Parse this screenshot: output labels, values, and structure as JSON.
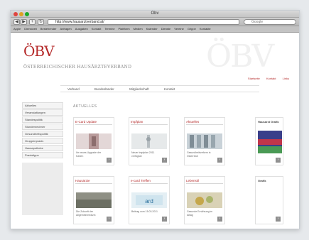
{
  "window": {
    "title": "Öbv",
    "url": "http://www.hausarztverband.at/",
    "search_placeholder": "Google"
  },
  "bookmarks": [
    "Apple",
    "Dienstzeit",
    "Bestehender",
    "Anfragen",
    "Ausgaben",
    "Kontakt",
    "Termine",
    "Plattform",
    "Medien",
    "Kalender",
    "Dienste",
    "Vereine",
    "Grippe",
    "Kontakte"
  ],
  "site": {
    "logo": "ÖBV",
    "tagline": "ÖSTERREICHISCHER HAUSÄRZTEVERBAND",
    "watermark": "ÖBV",
    "toplinks": [
      "Startseite",
      "Kontakt",
      "Links"
    ],
    "menu": [
      "Verband",
      "Bundesländer",
      "Mitgliedschaft",
      "Kontakt"
    ]
  },
  "sidebar": {
    "items": [
      "Aktuelles",
      "Veranstaltungen",
      "Standespolitik",
      "Stundenrechner",
      "Gesundheitspolitik",
      "Gruppenpraxis",
      "Hausapotheke",
      "Praxistipps"
    ]
  },
  "news": {
    "title": "AKTUELLES",
    "cards": [
      {
        "title": "E-Card Update",
        "text": "Ihr neues Upgrade der Karten"
      },
      {
        "title": "Impfplan",
        "text": "Neuer Impfplan 2011 verfügbar"
      },
      {
        "title": "Aktuelles",
        "text": "Gesundheitsreform in Österreich"
      },
      {
        "title": "Hausärzte",
        "text": "Die Zukunft der Allgemeinmedizin"
      },
      {
        "title": "e-card Treffen",
        "text": "Beitrag vom 15.03.2011"
      },
      {
        "title": "Lebenstil",
        "text": "Gesunde Ernährung im Alltag"
      }
    ]
  },
  "right": {
    "box1_title": "Hausarzt Grafik",
    "box2_title": "Grafik"
  },
  "colors": {
    "brand": "#b52a2a",
    "muted": "#7d7d7d"
  }
}
